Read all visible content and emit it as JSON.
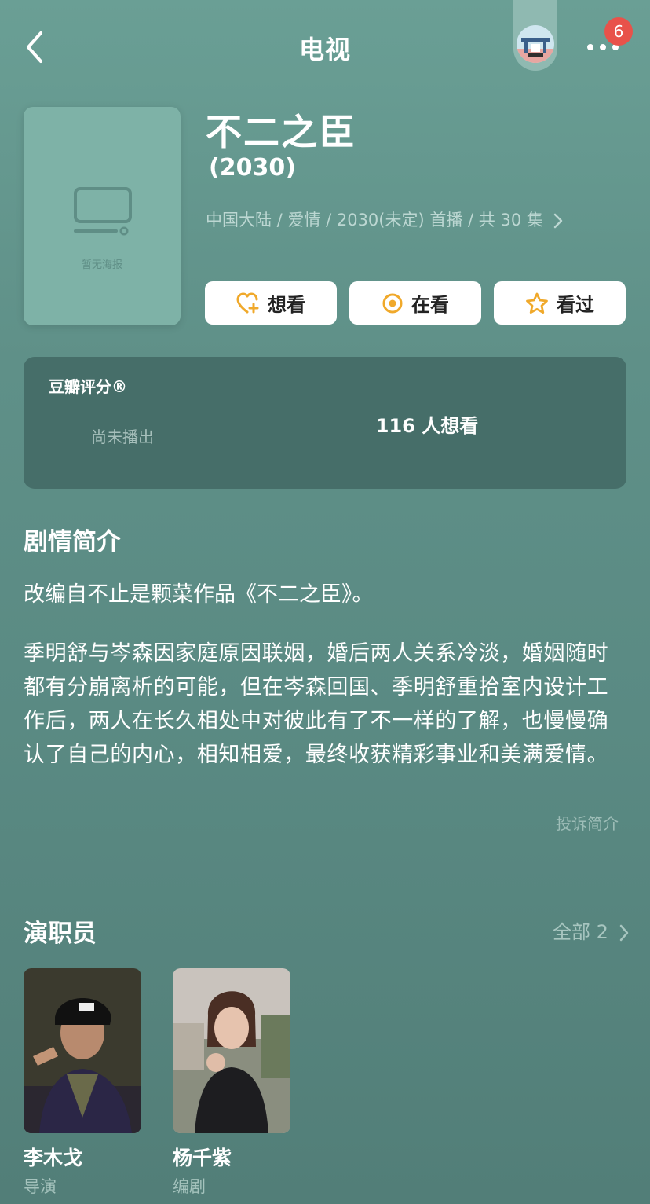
{
  "header": {
    "title": "电视",
    "notification_count": "6"
  },
  "poster": {
    "placeholder_text": "暂无海报"
  },
  "show": {
    "title": "不二之臣",
    "year": "(2030)",
    "meta": "中国大陆 / 爱情 / 2030(未定) 首播 / 共 30 集"
  },
  "actions": {
    "want": "想看",
    "watching": "在看",
    "watched": "看过"
  },
  "rating": {
    "label": "豆瓣评分®",
    "status": "尚未播出",
    "want_count": "116 人想看"
  },
  "synopsis": {
    "heading": "剧情简介",
    "p1": "改编自不止是颗菜作品《不二之臣》。",
    "p2": "季明舒与岑森因家庭原因联姻，婚后两人关系冷淡，婚姻随时都有分崩离析的可能，但在岑森回国、季明舒重拾室内设计工作后，两人在长久相处中对彼此有了不一样的了解，也慢慢确认了自己的内心，相知相爱，最终收获精彩事业和美满爱情。",
    "report": "投诉简介"
  },
  "cast": {
    "heading": "演职员",
    "all_label": "全部 2",
    "members": [
      {
        "name": "李木戈",
        "role": "导演"
      },
      {
        "name": "杨千紫",
        "role": "编剧"
      }
    ]
  },
  "colors": {
    "accent": "#f0a92b",
    "badge": "#e8524a",
    "card": "#466e69"
  }
}
